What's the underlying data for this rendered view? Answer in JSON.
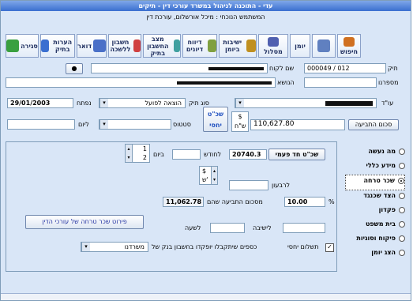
{
  "window": {
    "title": "עדי - התוכנה לניהול במשרד עורכי דין - תיקים"
  },
  "header": {
    "user_line": "המשתמש הנוכחי : מיכל אורשלום, עורכת דין"
  },
  "toolbar": {
    "buttons": [
      {
        "label": "סגירה",
        "icon": "door-exit-icon",
        "color": "#3aa040"
      },
      {
        "label": "הערות בתיק",
        "icon": "notes-icon",
        "color": "#3a6fd0"
      },
      {
        "label": "דואר",
        "icon": "mail-icon",
        "color": "#4a70c8"
      },
      {
        "label": "חשבון ללשכה",
        "icon": "invoice-icon",
        "color": "#d04040"
      },
      {
        "label": "מצב החשבון בתיק",
        "icon": "account-status-icon",
        "color": "#40a0a0"
      },
      {
        "label": "דיווח דיונים",
        "icon": "hearing-report-icon",
        "color": "#80a040"
      },
      {
        "label": "ישיבות ביומן",
        "icon": "meetings-icon",
        "color": "#c09020"
      },
      {
        "label": "מסלול",
        "icon": "track-icon",
        "color": "#5060b0"
      },
      {
        "label": "יומן",
        "icon": "diary-icon",
        "color": "#30a0d0"
      },
      {
        "label": "",
        "icon": "calendar-icon",
        "color": "#6080c0"
      },
      {
        "label": "חיפוש",
        "icon": "search-grid-icon",
        "color": "#d07020"
      }
    ]
  },
  "case": {
    "case_label": "תיק",
    "case_number": "000049 / 012",
    "client_label": "שם לקוח",
    "serial_label": "מספרנו",
    "subject_label": "הנושא",
    "lawyer_label": "עו\"ד",
    "case_type_label": "סוג תיק",
    "case_type_value": "הוצאה לפועל",
    "opened_label": "נפתח",
    "opened_value": "29/01/2003",
    "claim_button": "סכום התביעה",
    "claim_value": "110,627.80",
    "currency_symbol": "$",
    "currency_unit": "ש\"ח",
    "fee_button": "שכ\"ט יחסי",
    "status_label": "סטטוס",
    "settled_label": "ליום"
  },
  "fee_panel": {
    "agreed_fee_button": "שכ\"ט חד פעמי",
    "agreed_fee_value": "20740.3",
    "monthly_label": "לחודש",
    "day_label": "ביום",
    "day_spin_top": "1",
    "day_spin_bottom": "2",
    "quarterly_label": "לרבעון",
    "currency_top": "$",
    "currency_bottom": "ש'",
    "percent_label": "%",
    "percent_value": "10.00",
    "from_claim_label": "מסכום התביעה שהם",
    "from_claim_value": "11,062.78",
    "per_session_label": "לישיבה",
    "per_hour_label": "לשעה",
    "breakdown_button": "פירוט שכר טרחה של עורכי הדין",
    "relative_pay_label": "תשלום יחסי",
    "relative_pay_text": "כספים שיתקבלו יופקדו בחשבון בנק של",
    "bank_select_value": "משרדנו"
  },
  "sections": [
    {
      "label": "מה נעשה",
      "selected": false
    },
    {
      "label": "מידע כללי",
      "selected": false
    },
    {
      "label": "שכר טרחה",
      "selected": true
    },
    {
      "label": "הצד שכנגד",
      "selected": false
    },
    {
      "label": "פקדון",
      "selected": false
    },
    {
      "label": "בית משפט",
      "selected": false
    },
    {
      "label": "פיקוח וסוגיות",
      "selected": false
    },
    {
      "label": "הצג יומן",
      "selected": false
    }
  ]
}
